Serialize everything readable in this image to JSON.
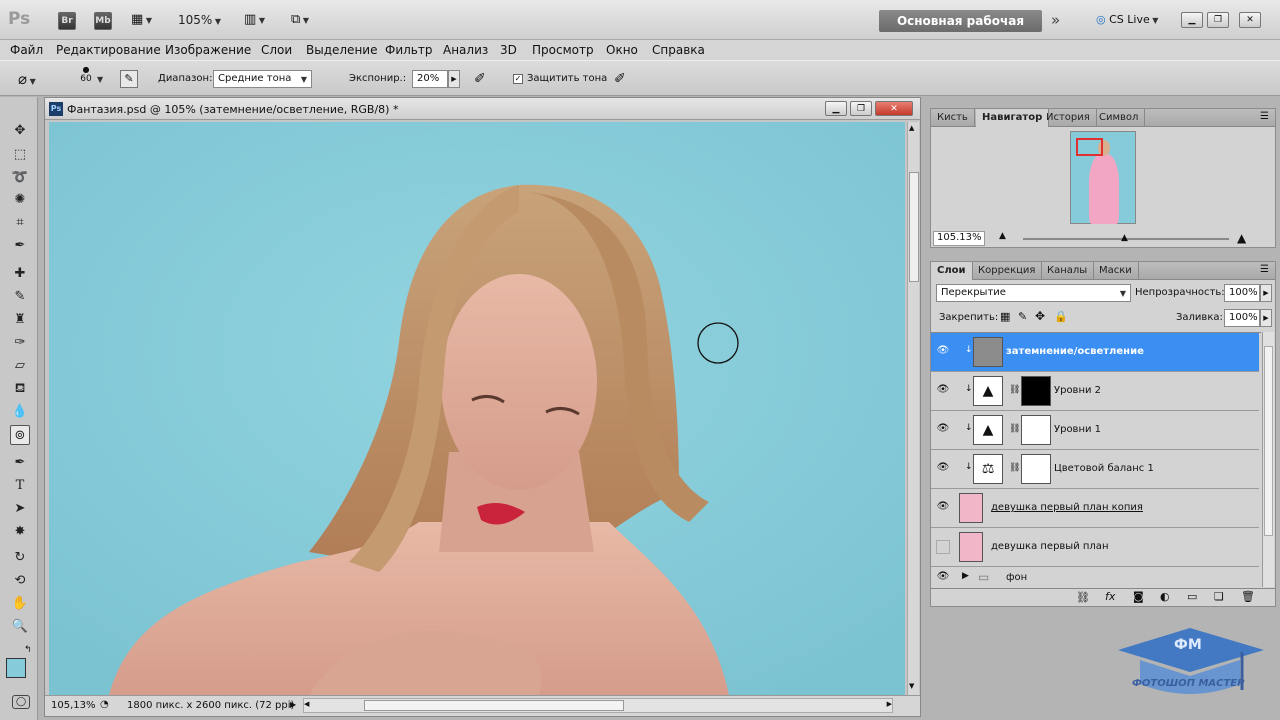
{
  "app": {
    "logo": "Ps",
    "br": "Br",
    "mb": "Mb",
    "zoom": "105%",
    "workspace": "Основная рабочая среда",
    "cslive": "CS Live"
  },
  "menu": [
    "Файл",
    "Редактирование",
    "Изображение",
    "Слои",
    "Выделение",
    "Фильтр",
    "Анализ",
    "3D",
    "Просмотр",
    "Окно",
    "Справка"
  ],
  "options": {
    "brush_size": "60",
    "range_label": "Диапазон:",
    "range_value": "Средние тона",
    "exposure_label": "Экспонир.:",
    "exposure_value": "20%",
    "protect_label": "Защитить тона",
    "protect_checked": true
  },
  "document": {
    "title": "Фантазия.psd @ 105% (затемнение/осветление, RGB/8) *",
    "zoom": "105,13%",
    "size": "1800 пикс. x 2600 пикс. (72 ppi)",
    "bg_color": "#86cbd9"
  },
  "navigator": {
    "tabs": [
      "Кисть",
      "Навигатор",
      "История",
      "Символ"
    ],
    "active_tab": "Навигатор",
    "zoom": "105.13%"
  },
  "layers_panel": {
    "tabs": [
      "Слои",
      "Коррекция",
      "Каналы",
      "Маски"
    ],
    "active_tab": "Слои",
    "blend_mode": "Перекрытие",
    "opacity_label": "Непрозрачность:",
    "opacity": "100%",
    "lock_label": "Закрепить:",
    "fill_label": "Заливка:",
    "fill": "100%",
    "layers": [
      {
        "name": "затемнение/осветление",
        "selected": true,
        "visible": true
      },
      {
        "name": "Уровни 2",
        "selected": false,
        "visible": true
      },
      {
        "name": "Уровни 1",
        "selected": false,
        "visible": true
      },
      {
        "name": "Цветовой баланс 1",
        "selected": false,
        "visible": true
      },
      {
        "name": "девушка первый план копия",
        "selected": false,
        "visible": true
      },
      {
        "name": "девушка первый план",
        "selected": false,
        "visible": false
      },
      {
        "name": "фон",
        "selected": false,
        "visible": true
      }
    ]
  },
  "watermark": {
    "line1": "ФМ",
    "line2": "ФОТОШОП МАСТЕР"
  },
  "colors": {
    "accent": "#3b8ff2",
    "foreground_swatch": "#86cbd9",
    "background_swatch": "#ffffff"
  }
}
